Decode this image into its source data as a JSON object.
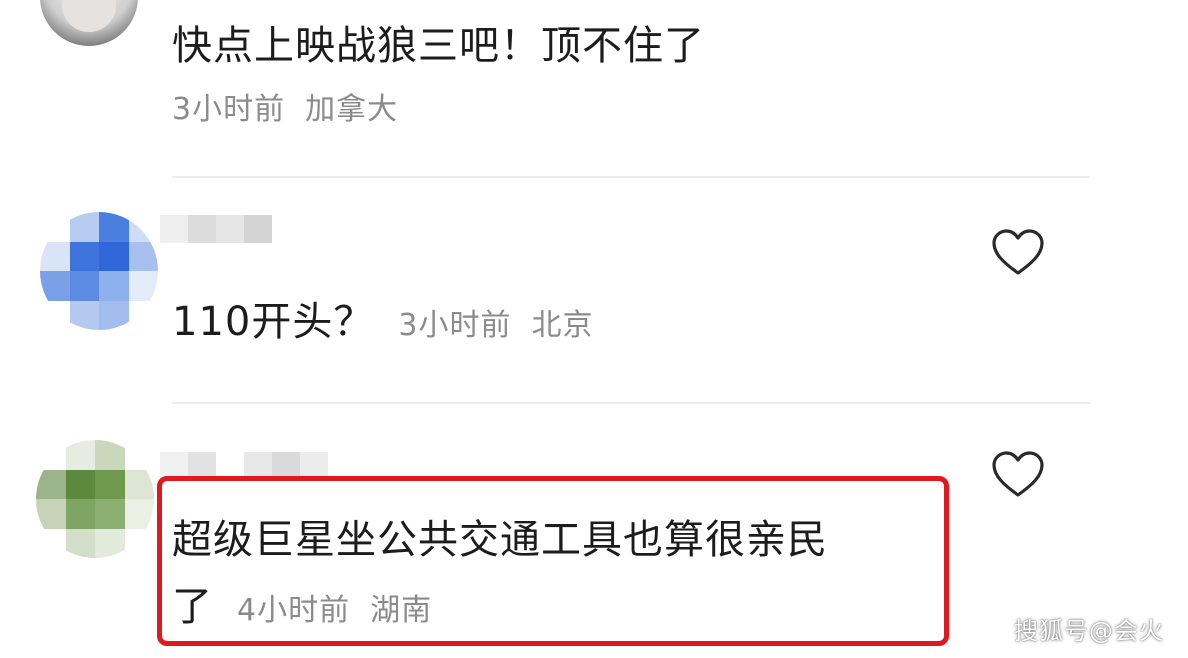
{
  "comments": [
    {
      "text": "快点上映战狼三吧！顶不住了",
      "time": "3小时前",
      "location": "加拿大"
    },
    {
      "text": "110开头？",
      "time": "3小时前",
      "location": "北京"
    },
    {
      "text_line1": "超级巨星坐公共交通工具也算很亲民",
      "text_line2": "了",
      "time": "4小时前",
      "location": "湖南"
    }
  ],
  "watermark": "搜狐号@会火",
  "colors": {
    "highlight": "#e0191f",
    "meta_text": "#8b8b8b",
    "main_text": "#1c1c1c",
    "heart_stroke": "#2a2a2a"
  },
  "icons": {
    "like": "heart-outline-icon"
  }
}
